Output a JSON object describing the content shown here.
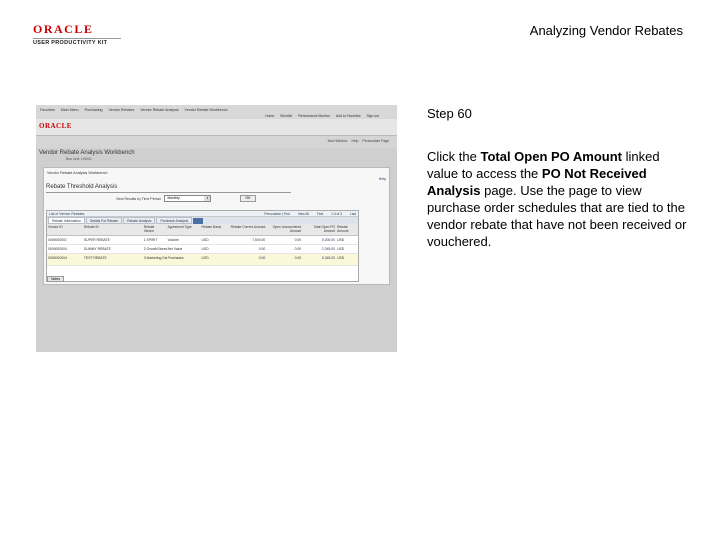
{
  "logo": {
    "word": "ORACLE",
    "subtitle": "USER PRODUCTIVITY KIT"
  },
  "doc_title": "Analyzing Vendor Rebates",
  "screenshot": {
    "nav": [
      "Favorites",
      "Main Menu",
      "Purchasing",
      "Vendor Rebates",
      "Vendor Rebate Analysis",
      "Vendor Rebate Workbench"
    ],
    "nav2": [
      "Home",
      "Worklist",
      "Performance Monitor",
      "Add to Favorites",
      "Sign out"
    ],
    "oracle": "ORACLE",
    "links": [
      "New Window",
      "Help",
      "Personalize Page"
    ],
    "workbench_title": "Vendor Rebate Analysis Workbench",
    "unit": "Bus Unit: US001",
    "crumb": "Vendor Rebate Analysis Workbench",
    "help": "Help",
    "panel_title": "Rebate Threshold Analysis",
    "filter_label": "View Results by Time Period:",
    "filter_value": "Monthly",
    "ok_label": "OK",
    "grid_title": "List of Vendor Rebates",
    "grid_nav": [
      "Personalize | Find",
      "View All",
      "First",
      "1-3 of 3",
      "Last"
    ],
    "tabs": [
      "Rebate Information",
      "Details For Rebate",
      "Rebate Analysis",
      "Purchase Analysis"
    ],
    "columns": [
      "Vendor ID",
      "Rebate ID",
      "Rebate Vendor",
      "Agreement Type",
      "Rebate Basis",
      "Rebate Current Amount",
      "Open Unvouchered Amount",
      "Total Open PO Amount",
      "Rebate Amount"
    ],
    "rows": [
      [
        "0000000001",
        "SUPER REBATE",
        "1 SPIRIT",
        "Volume",
        "USD",
        "7,500.00",
        "0.00",
        "5,000.00",
        "USD"
      ],
      [
        "0000000004",
        "DUMMY REBATE",
        "2 GrowthStores",
        "Net Value",
        "USD",
        "0.00",
        "0.00",
        "2,345.00",
        "USD"
      ],
      [
        "0000000004",
        "TEST REBATE",
        "3 Marketing Distributor",
        "Purchases",
        "USD",
        "0.00",
        "0.00",
        "5,345.00",
        "USD"
      ]
    ],
    "notes_label": "Notes"
  },
  "step": {
    "number": "Step 60",
    "text_1": "Click the ",
    "bold_1": "Total Open PO Amount",
    "text_2": " linked value to access the ",
    "bold_2": "PO Not Received Analysis",
    "text_3": " page. Use the page to view purchase order schedules that are tied to the vendor rebate that have not been received or vouchered."
  }
}
